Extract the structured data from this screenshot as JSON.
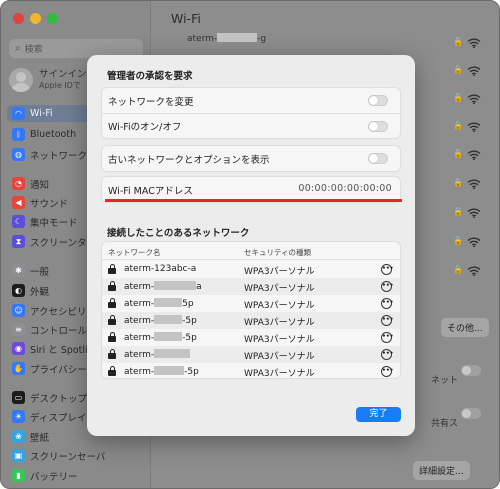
{
  "window": {
    "traffic_lights": [
      "#e0443e",
      "#f0b529",
      "#2dbe3f"
    ],
    "title": "Wi-Fi"
  },
  "sidebar": {
    "search_placeholder": "検索",
    "account_line1": "サインイン",
    "account_line2": "Apple IDで",
    "items": [
      {
        "label": "Wi-Fi",
        "icon": "wifi-icon",
        "color": "#3478f6",
        "active": true
      },
      {
        "label": "Bluetooth",
        "icon": "bluetooth-icon",
        "color": "#3478f6"
      },
      {
        "label": "ネットワーク",
        "icon": "globe-icon",
        "color": "#3478f6"
      },
      {
        "label": "通知",
        "icon": "bell-icon",
        "color": "#e5453d"
      },
      {
        "label": "サウンド",
        "icon": "speaker-icon",
        "color": "#e5453d"
      },
      {
        "label": "集中モード",
        "icon": "moon-icon",
        "color": "#5a4fd6"
      },
      {
        "label": "スクリーンタイム",
        "icon": "hourglass-icon",
        "color": "#5a4fd6"
      },
      {
        "label": "一般",
        "icon": "gear-icon",
        "color": "#8e8e93"
      },
      {
        "label": "外観",
        "icon": "appearance-icon",
        "color": "#1c1c1e"
      },
      {
        "label": "アクセシビリティ",
        "icon": "accessibility-icon",
        "color": "#3478f6"
      },
      {
        "label": "コントロールセ",
        "icon": "control-center-icon",
        "color": "#8e8e93"
      },
      {
        "label": "Siri と Spotlight",
        "icon": "siri-icon",
        "color": "#6e4bd6"
      },
      {
        "label": "プライバシーと",
        "icon": "hand-icon",
        "color": "#3478f6"
      },
      {
        "label": "デスクトップと",
        "icon": "desktop-icon",
        "color": "#1c1c1e"
      },
      {
        "label": "ディスプレイ",
        "icon": "display-icon",
        "color": "#3478f6"
      },
      {
        "label": "壁紙",
        "icon": "wallpaper-icon",
        "color": "#33a4e0"
      },
      {
        "label": "スクリーンセーバ",
        "icon": "screensaver-icon",
        "color": "#33a4e0"
      },
      {
        "label": "バッテリー",
        "icon": "battery-icon",
        "color": "#35c759"
      }
    ]
  },
  "background": {
    "top_network": "aterm-",
    "top_network_suffix": "-g",
    "other_button": "その他...",
    "text_1": "ネット",
    "text_2": "共有ス",
    "details_button": "詳細設定..."
  },
  "modal": {
    "title": "管理者の承認を要求",
    "settings": [
      {
        "label": "ネットワークを変更"
      },
      {
        "label": "Wi-Fiのオン/オフ"
      }
    ],
    "legacy_label": "古いネットワークとオプションを表示",
    "mac_label": "Wi-Fi MACアドレス",
    "mac_value": "00:00:00:00:00:00",
    "accent_color": "#e8262a",
    "known_title": "接続したことのあるネットワーク",
    "columns": {
      "name": "ネットワーク名",
      "security": "セキュリティの種類"
    },
    "networks": [
      {
        "prefix": "aterm-123abc-a",
        "suffix": "",
        "security": "WPA3パーソナル"
      },
      {
        "prefix": "aterm-",
        "suffix": "a",
        "security": "WPA3パーソナル"
      },
      {
        "prefix": "aterm-",
        "suffix": "5p",
        "security": "WPA3パーソナル"
      },
      {
        "prefix": "aterm-",
        "suffix": "-5p",
        "security": "WPA3パーソナル"
      },
      {
        "prefix": "aterm-",
        "suffix": "-5p",
        "security": "WPA3パーソナル"
      },
      {
        "prefix": "aterm-",
        "suffix": "",
        "security": "WPA3パーソナル"
      },
      {
        "prefix": "aterm-",
        "suffix": "-5p",
        "security": "WPA3パーソナル"
      }
    ],
    "more_glyph": "•••",
    "done_label": "完了",
    "done_color": "#1a7cf5"
  }
}
